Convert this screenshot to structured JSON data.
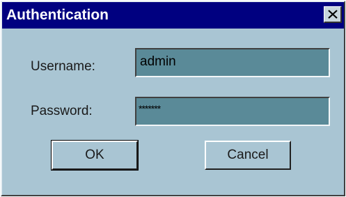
{
  "window": {
    "title": "Authentication",
    "close_icon": "close-icon"
  },
  "form": {
    "username_label": "Username:",
    "username_value": "admin",
    "password_label": "Password:",
    "password_value": "*******"
  },
  "buttons": {
    "ok_label": "OK",
    "cancel_label": "Cancel"
  },
  "colors": {
    "titlebar": "#000080",
    "dialog_background": "#a9c5d3",
    "field_background": "#5a8a98"
  }
}
